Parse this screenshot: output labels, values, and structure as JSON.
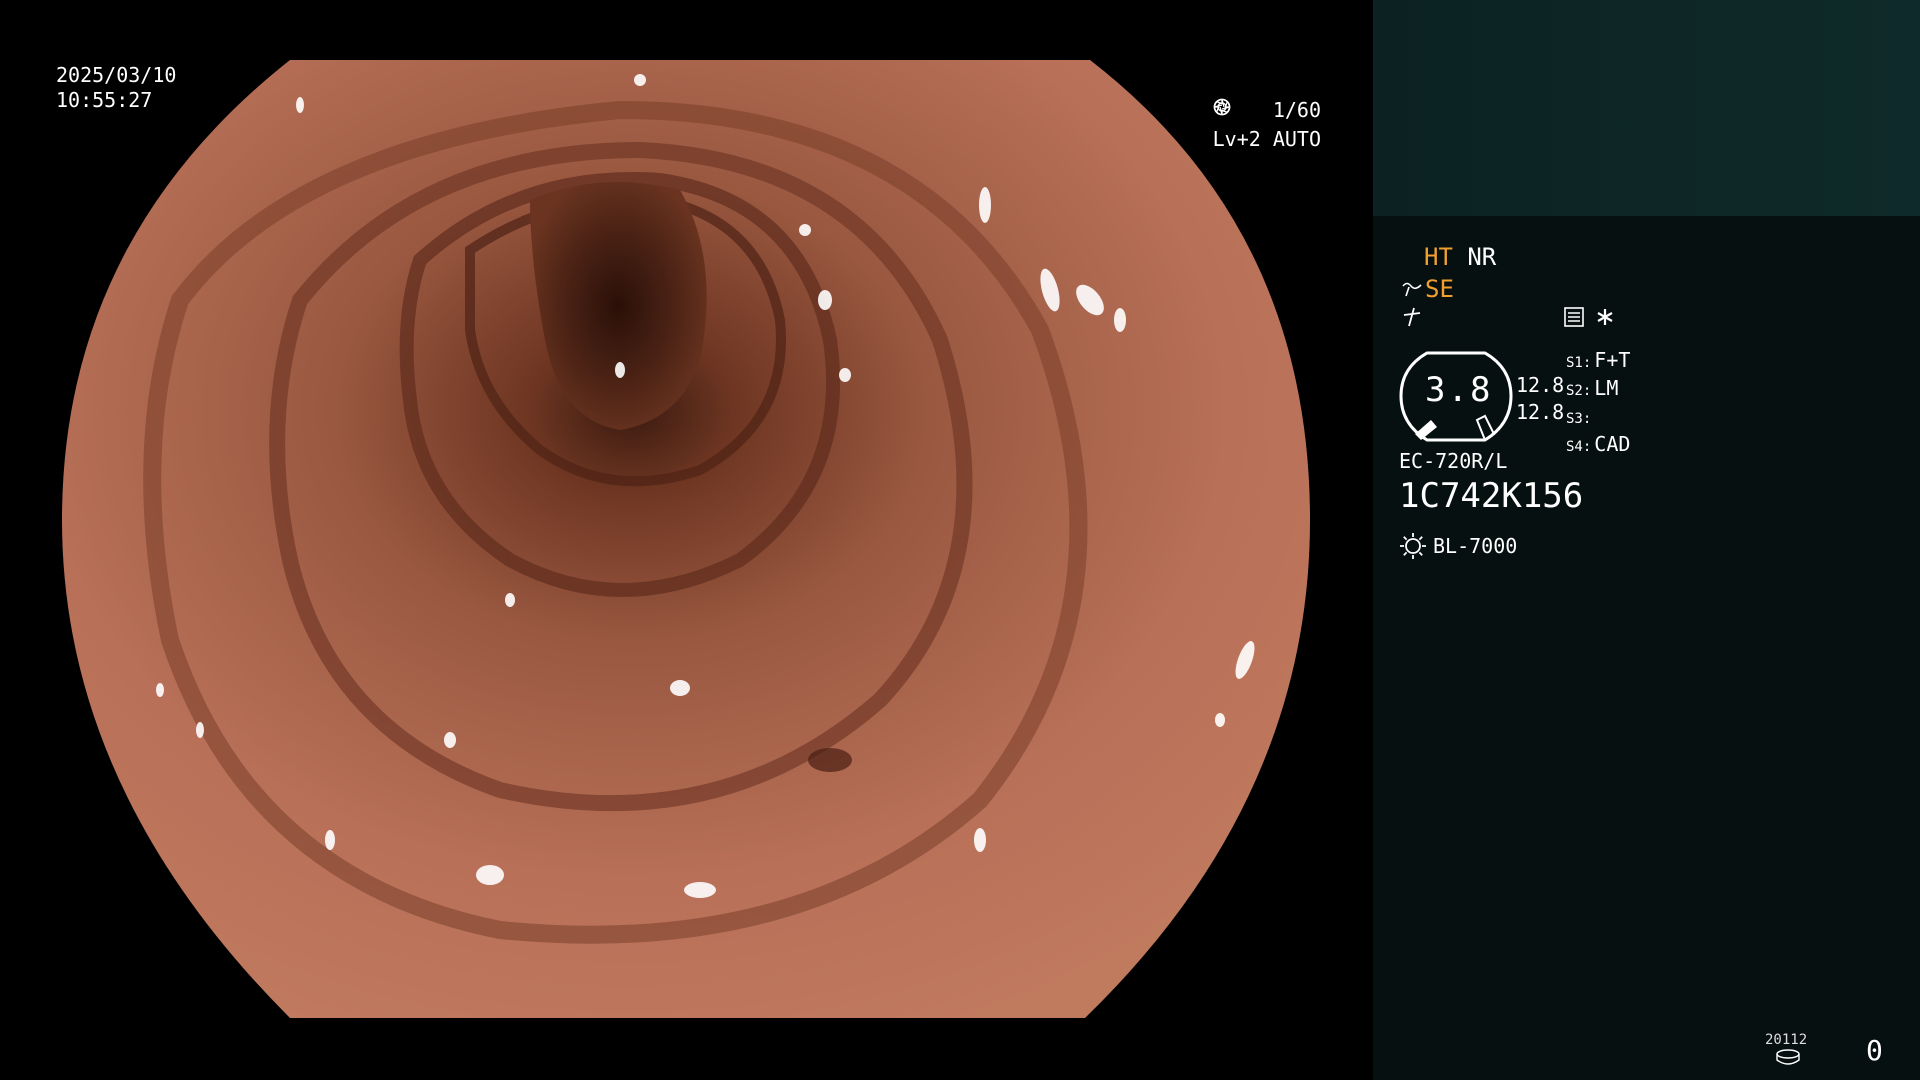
{
  "overlay": {
    "date": "2025/03/10",
    "time": "10:55:27",
    "shutter_speed": "1/60",
    "level": "Lv+2 AUTO"
  },
  "panel": {
    "ht_label": "HT",
    "nr_label": "NR",
    "se_label": "SE",
    "gauge_value": "3.8",
    "readout_1": "12.8",
    "readout_2": "12.8",
    "switches": [
      {
        "key": "S1:",
        "value": "F+T"
      },
      {
        "key": "S2:",
        "value": "LM"
      },
      {
        "key": "S3:",
        "value": ""
      },
      {
        "key": "S4:",
        "value": "CAD"
      }
    ],
    "scope_model": "EC-720R/L",
    "serial": "1C742K156",
    "light_source": "BL-7000",
    "counter_small": "20112",
    "counter": "0"
  },
  "colors": {
    "accent_orange": "#f0a030",
    "panel_bg": "#071010",
    "preview_bg": "#0f2a2a"
  },
  "icons": {
    "shutter": "aperture-icon",
    "auto": "iris-icon",
    "structure": "structure-enhance-icon",
    "freeze": "freeze-icon",
    "memory": "memory-icon",
    "asterisk": "asterisk-icon",
    "light": "sun-icon",
    "disk": "disk-icon"
  }
}
